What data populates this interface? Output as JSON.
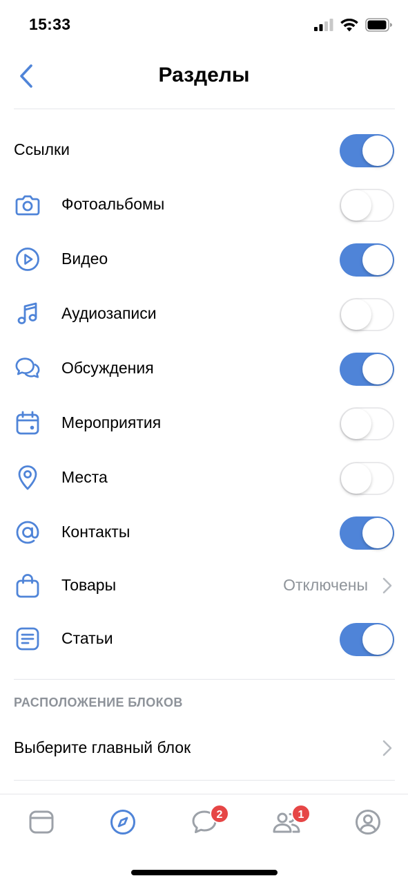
{
  "status_bar": {
    "time": "15:33"
  },
  "header": {
    "title": "Разделы",
    "back_icon": "chevron-left-icon"
  },
  "colors": {
    "accent": "#4f84d8",
    "toggle_off_border": "#e9e9eb",
    "secondary_text": "#8f949a",
    "badge": "#e64646"
  },
  "sections": [
    {
      "label": "Ссылки",
      "icon": null,
      "control": "toggle",
      "on": true
    },
    {
      "label": "Фотоальбомы",
      "icon": "camera-icon",
      "control": "toggle",
      "on": false
    },
    {
      "label": "Видео",
      "icon": "play-circle-icon",
      "control": "toggle",
      "on": true
    },
    {
      "label": "Аудиозаписи",
      "icon": "music-note-icon",
      "control": "toggle",
      "on": false
    },
    {
      "label": "Обсуждения",
      "icon": "discussion-icon",
      "control": "toggle",
      "on": true
    },
    {
      "label": "Мероприятия",
      "icon": "calendar-icon",
      "control": "toggle",
      "on": false
    },
    {
      "label": "Места",
      "icon": "location-pin-icon",
      "control": "toggle",
      "on": false
    },
    {
      "label": "Контакты",
      "icon": "at-sign-icon",
      "control": "toggle",
      "on": true
    },
    {
      "label": "Товары",
      "icon": "shopping-bag-icon",
      "control": "disclosure",
      "value": "Отключены"
    },
    {
      "label": "Статьи",
      "icon": "article-icon",
      "control": "toggle",
      "on": true
    }
  ],
  "layout_section": {
    "header": "РАСПОЛОЖЕНИЕ БЛОКОВ",
    "main_block_label": "Выберите главный блок"
  },
  "tab_bar": {
    "tabs": [
      {
        "name": "news-tab",
        "icon": "feed-icon"
      },
      {
        "name": "discover-tab",
        "icon": "compass-icon",
        "active": true
      },
      {
        "name": "messages-tab",
        "icon": "chat-bubble-icon",
        "badge": "2"
      },
      {
        "name": "friends-tab",
        "icon": "friends-icon",
        "badge": "1"
      },
      {
        "name": "profile-tab",
        "icon": "profile-icon"
      }
    ]
  }
}
